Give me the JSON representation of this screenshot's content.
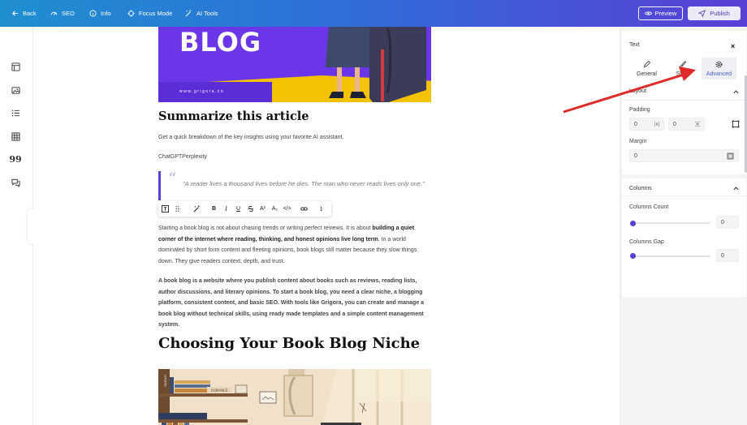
{
  "topbar": {
    "back": "Back",
    "seo": "SEO",
    "info": "Info",
    "focus_mode": "Focus Mode",
    "ai_tools": "AI Tools",
    "preview": "Preview",
    "publish": "Publish",
    "icons": {
      "back": "arrow-left-icon",
      "seo": "gauge-icon",
      "info": "info-icon",
      "focus": "focus-icon",
      "ai": "magic-wand-icon",
      "preview": "eye-icon",
      "publish": "send-icon"
    }
  },
  "left_sidebar": {
    "icons": [
      "layout-icon",
      "image-icon",
      "list-icon",
      "table-icon",
      "quote-icon",
      "comment-icon",
      "collapse-chevron-icon"
    ]
  },
  "document": {
    "hero": {
      "title": "BLOG",
      "url": "www.grigora.co"
    },
    "heading1": "Summarize this article",
    "para1": "Get a quick breakdown of the key insights using your favorite AI assistant.",
    "para2": "ChatGPTPerplexity",
    "quote_mark": "“",
    "quote_text": "\"A reader lives a thousand lives before he dies. The man who never reads lives only one.\"",
    "para3_start": "Starting a book blog is not about chasing trends or writing perfect reviews. It is about ",
    "para3_bold": "building a quiet corner of the internet where reading, thinking, and honest opinions live long term",
    "para3_end": ". In a world dominated by short form content and fleeting opinions, book blogs still matter because they slow things down. They give readers context, depth, and trust.",
    "para4": "A book blog is a website where you publish content about books such as reviews, reading lists, author discussions, and literary opinions. To start a book blog, you need a clear niche, a blogging platform, consistent content, and basic SEO. With tools like Grigora, you can create and manage a book blog without technical skills, using ready made templates and a simple content management system.",
    "heading2": "Choosing Your Book Blog Niche",
    "image2_labels": [
      "FANTASY",
      "ROMANCE"
    ]
  },
  "format_toolbar": {
    "items": [
      "text-type-icon",
      "drag-handle-icon",
      "ai-wand-icon",
      "bold-icon",
      "italic-icon",
      "underline-icon",
      "strikethrough-icon",
      "superscript-icon",
      "subscript-icon",
      "code-icon",
      "link-icon",
      "more-icon"
    ],
    "labels": {
      "bold": "B",
      "italic": "I",
      "underline": "U",
      "sup": "A²",
      "sub": "A₂",
      "code": "</>",
      "more": "⋮"
    }
  },
  "right_panel": {
    "title": "Text",
    "close": "×",
    "tabs": [
      {
        "label": "General",
        "icon": "pen-icon",
        "active": false
      },
      {
        "label": "Style",
        "icon": "brush-icon",
        "active": false
      },
      {
        "label": "Advanced",
        "icon": "gear-icon",
        "active": true
      }
    ],
    "layout": {
      "title": "Layout",
      "padding_label": "Padding",
      "padding_values": [
        "0",
        "0"
      ],
      "margin_label": "Margin",
      "margin_value": "0"
    },
    "columns": {
      "title": "Columns",
      "count_label": "Columns Count",
      "count_value": "0",
      "gap_label": "Columns Gap",
      "gap_value": "0"
    }
  },
  "colors": {
    "accent": "#5b3ed6",
    "topbar_start": "#1f8fd0",
    "topbar_end": "#5a3fd6",
    "annotation": "#e02a2a"
  }
}
